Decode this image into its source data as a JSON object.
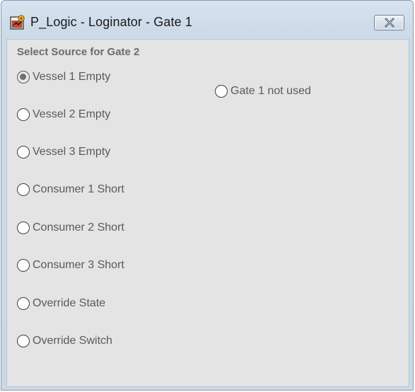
{
  "window": {
    "title": "P_Logic - Loginator - Gate 1"
  },
  "group": {
    "label": "Select Source for Gate 2"
  },
  "options": [
    {
      "label": "Vessel 1 Empty",
      "checked": true
    },
    {
      "label": "Vessel 2 Empty",
      "checked": false
    },
    {
      "label": "Vessel 3 Empty",
      "checked": false
    },
    {
      "label": "Consumer 1 Short",
      "checked": false
    },
    {
      "label": "Consumer 2 Short",
      "checked": false
    },
    {
      "label": "Consumer 3 Short",
      "checked": false
    },
    {
      "label": "Override State",
      "checked": false
    },
    {
      "label": "Override Switch",
      "checked": false
    }
  ],
  "side_option": {
    "label": "Gate 1 not used",
    "checked": false
  },
  "icons": {
    "app": "app-gear-icon",
    "close": "close-icon"
  }
}
